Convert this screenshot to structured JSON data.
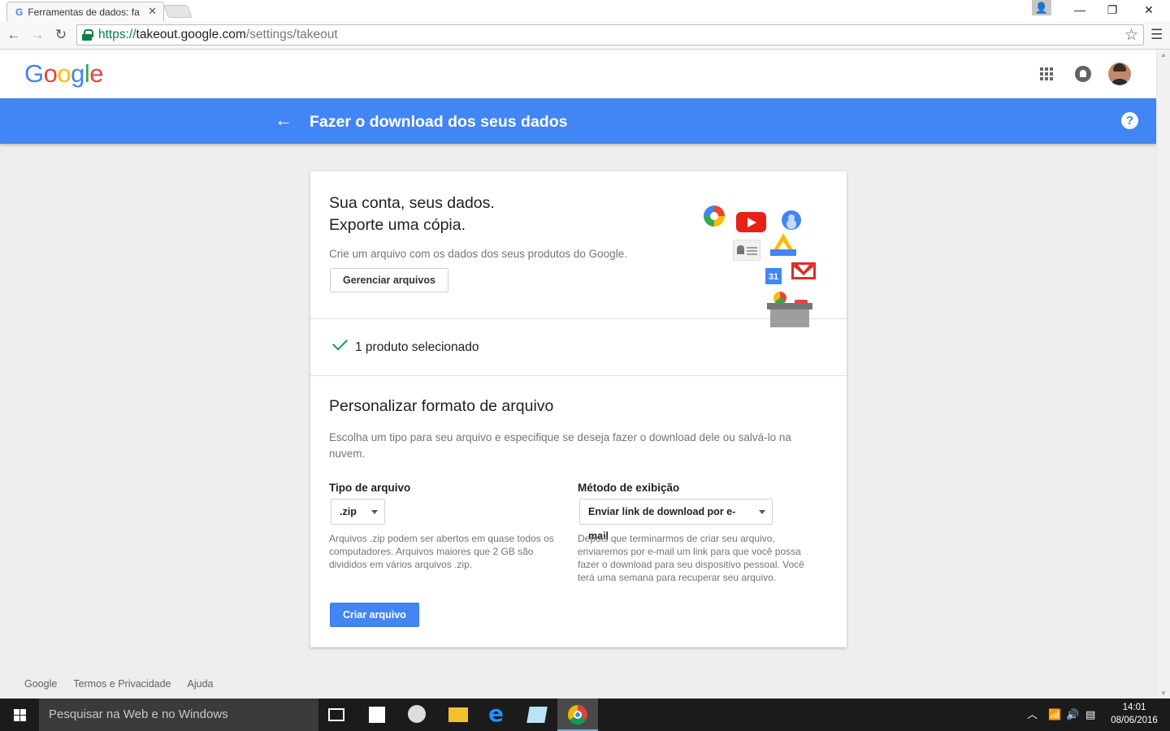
{
  "browser": {
    "tab_title": "Ferramentas de dados: fa",
    "tab_favicon": "G",
    "url_scheme": "https://",
    "url_host": "takeout.google.com",
    "url_path": "/settings/takeout"
  },
  "header": {
    "logo_letters": [
      "G",
      "o",
      "o",
      "g",
      "l",
      "e"
    ]
  },
  "bluebar": {
    "title": "Fazer o download dos seus dados",
    "help_symbol": "?"
  },
  "intro": {
    "headline_line1": "Sua conta, seus dados.",
    "headline_line2": "Exporte uma cópia.",
    "description": "Crie um arquivo com os dados dos seus produtos do Google.",
    "manage_button": "Gerenciar arquivos",
    "calendar_day": "31"
  },
  "selection": {
    "text": "1 produto selecionado"
  },
  "format": {
    "title": "Personalizar formato de arquivo",
    "description": "Escolha um tipo para seu arquivo e especifique se deseja fazer o download dele ou salvá-lo na nuvem.",
    "file_type_label": "Tipo de arquivo",
    "file_type_value": ".zip",
    "file_type_help": "Arquivos .zip podem ser abertos em quase todos os computadores. Arquivos maiores que 2 GB são divididos em vários arquivos .zip.",
    "delivery_label": "Método de exibição",
    "delivery_value": "Enviar link de download por e-mail",
    "delivery_help": "Depois que terminarmos de criar seu arquivo, enviaremos por e-mail um link para que você possa fazer o download para seu dispositivo pessoal. Você terá uma semana para recuperar seu arquivo.",
    "create_button": "Criar arquivo"
  },
  "footer": {
    "links": [
      "Google",
      "Termos e Privacidade",
      "Ajuda"
    ]
  },
  "taskbar": {
    "search_placeholder": "Pesquisar na Web e no Windows",
    "time": "14:01",
    "date": "08/06/2016"
  },
  "colors": {
    "accent_blue": "#4285f4",
    "check_green": "#0f9d58",
    "page_bg": "#eeeeee"
  }
}
